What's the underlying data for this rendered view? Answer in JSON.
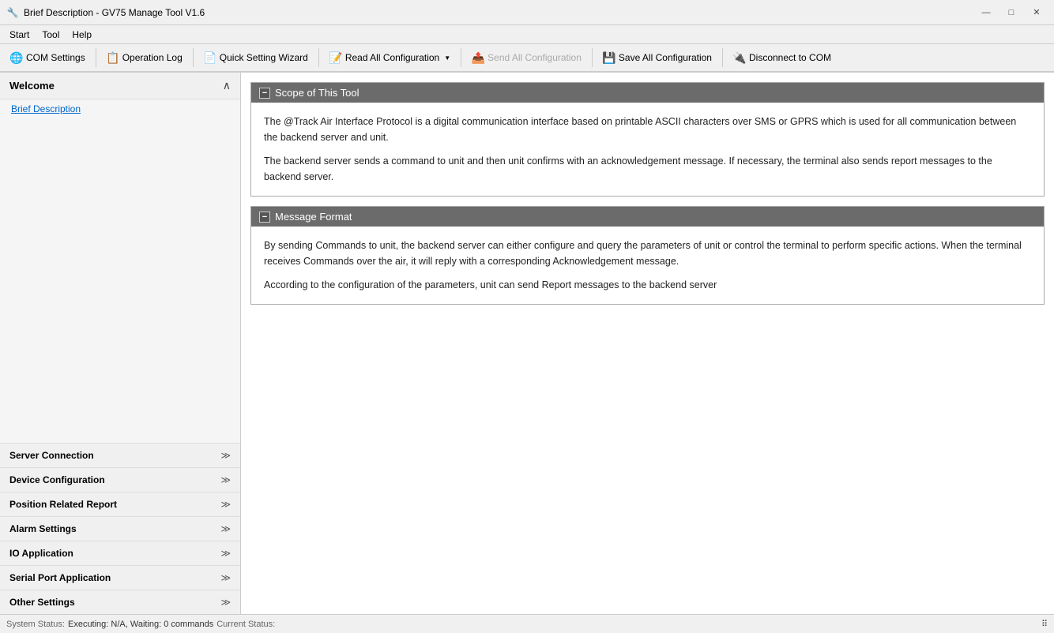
{
  "titlebar": {
    "icon": "🔧",
    "title": "Brief Description - GV75 Manage Tool V1.6",
    "minimize": "—",
    "maximize": "□",
    "close": "✕"
  },
  "menubar": {
    "items": [
      "Start",
      "Tool",
      "Help"
    ]
  },
  "toolbar": {
    "buttons": [
      {
        "id": "com-settings",
        "icon": "🌐",
        "label": "COM Settings",
        "disabled": false
      },
      {
        "id": "operation-log",
        "icon": "📋",
        "label": "Operation Log",
        "disabled": false
      },
      {
        "id": "quick-setting",
        "icon": "📄",
        "label": "Quick Setting Wizard",
        "disabled": false
      },
      {
        "id": "read-all",
        "icon": "📝",
        "label": "Read All Configuration",
        "dropdown": true,
        "disabled": false
      },
      {
        "id": "send-all",
        "icon": "📤",
        "label": "Send All Configuration",
        "disabled": true
      },
      {
        "id": "save-all",
        "icon": "💾",
        "label": "Save All Configuration",
        "disabled": false
      },
      {
        "id": "disconnect",
        "icon": "🔌",
        "label": "Disconnect to COM",
        "disabled": false
      }
    ]
  },
  "sidebar": {
    "welcome_title": "Welcome",
    "brief_description_link": "Brief Description",
    "nav_items": [
      {
        "id": "server-connection",
        "label": "Server Connection"
      },
      {
        "id": "device-config",
        "label": "Device Configuration"
      },
      {
        "id": "position-report",
        "label": "Position Related Report"
      },
      {
        "id": "alarm-settings",
        "label": "Alarm Settings"
      },
      {
        "id": "io-application",
        "label": "IO Application"
      },
      {
        "id": "serial-port",
        "label": "Serial Port Application"
      },
      {
        "id": "other-settings",
        "label": "Other Settings"
      }
    ]
  },
  "content": {
    "sections": [
      {
        "id": "scope",
        "title": "Scope of This Tool",
        "paragraphs": [
          "The @Track Air Interface Protocol is a digital communication interface based on printable ASCII characters over SMS or GPRS which is used for all communication between the backend server and unit.",
          "The backend server sends a command to unit and then unit confirms with an acknowledgement message. If necessary, the terminal also sends report messages to the backend server."
        ]
      },
      {
        "id": "message-format",
        "title": "Message Format",
        "paragraphs": [
          "By sending Commands to unit, the backend server can either configure and query the parameters of unit or control the terminal to perform specific actions. When the terminal receives Commands over the air, it will reply with a corresponding Acknowledgement message.",
          "According to the configuration of the parameters, unit can send Report messages to the backend server"
        ]
      }
    ]
  },
  "statusbar": {
    "system_status_label": "System Status:",
    "system_status_value": "Executing: N/A, Waiting: 0 commands",
    "current_status_label": "Current Status:"
  }
}
